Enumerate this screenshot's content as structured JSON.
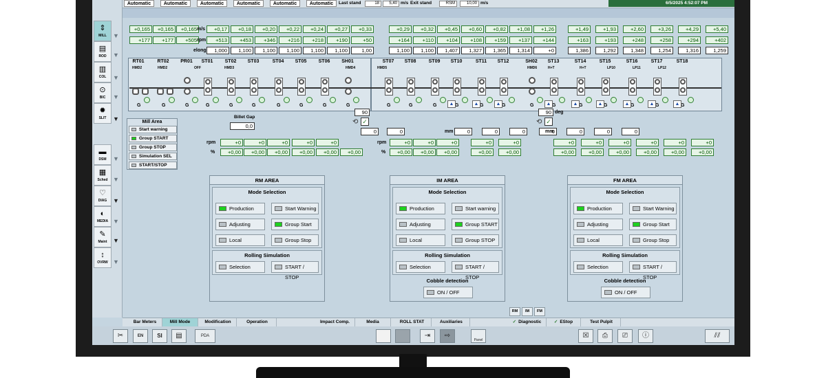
{
  "topbar": {
    "modes": [
      "Automatic",
      "Automatic",
      "Automatic",
      "Automatic",
      "Automatic",
      "Automatic"
    ],
    "last_stand_label": "Last stand",
    "last_stand_value": "18",
    "last_stand_speed": "5,40",
    "speed_unit": "m/s",
    "exit_stand_label": "Exit stand",
    "exit_stand_value": "RSM",
    "exit_stand_speed": "10,00",
    "exit_unit": "m/s",
    "datetime": "6/5/2025 4:52:07 PM"
  },
  "nav": [
    {
      "label": "MILL",
      "icon": "mill-icon",
      "glyph": "⇕"
    },
    {
      "label": "ROD",
      "icon": "rod-icon",
      "glyph": "▤"
    },
    {
      "label": "COL",
      "icon": "col-icon",
      "glyph": "▥"
    },
    {
      "label": "BIC",
      "icon": "bic-icon",
      "glyph": "⊙"
    },
    {
      "label": "SLIT",
      "icon": "slit-icon",
      "glyph": "✹"
    },
    {
      "label": "DSM",
      "icon": "dsm-icon",
      "glyph": "▬"
    },
    {
      "label": "Sched",
      "icon": "schedule-icon",
      "glyph": "▦"
    },
    {
      "label": "DIAG",
      "icon": "diag-icon",
      "glyph": "♡"
    },
    {
      "label": "MEDIA",
      "icon": "media-icon",
      "glyph": "◐"
    },
    {
      "label": "Maint",
      "icon": "maint-icon",
      "glyph": "✎"
    },
    {
      "label": "OVRW",
      "icon": "overview-icon",
      "glyph": "↕"
    }
  ],
  "units": {
    "ms": "m/s",
    "rpm": "rpm",
    "elong": "elong",
    "mm": "mm",
    "rpm2": "rpm",
    "pct": "%",
    "deg": "deg"
  },
  "speed_row": [
    "+0,165",
    "+0,165",
    "+0,165",
    "+0,17",
    "+0,18",
    "+0,20",
    "+0,22",
    "+0,24",
    "+0,27",
    "+0,33",
    "+0,29",
    "+0,32",
    "+0,45",
    "+0,60",
    "+0,82",
    "+1,08",
    "+1,26",
    "+1,49",
    "+1,93",
    "+2,60",
    "+3,26",
    "+4,29",
    "+5,40"
  ],
  "rpm_row": [
    "+177",
    "+177",
    "+505",
    "+513",
    "+453",
    "+346",
    "+216",
    "+218",
    "+190",
    "+50",
    "+164",
    "+110",
    "+104",
    "+108",
    "+159",
    "+137",
    "+144",
    "+163",
    "+193",
    "+248",
    "+258",
    "+294",
    "+402"
  ],
  "elong_row": [
    "1,000",
    "1,100",
    "1,100",
    "1,100",
    "1,100",
    "1,100",
    "1,00",
    "1,100",
    "1,100",
    "1,407",
    "1,327",
    "1,365",
    "1,314",
    "+0",
    "1,386",
    "1,292",
    "1,348",
    "1,254",
    "1,316",
    "1,259"
  ],
  "stands": [
    "RT01",
    "RT02",
    "PR01",
    "ST01",
    "ST02",
    "ST03",
    "ST04",
    "ST05",
    "ST06",
    "SH01",
    "ST07",
    "ST08",
    "ST09",
    "ST10",
    "ST11",
    "ST12",
    "SH02",
    "ST13",
    "ST14",
    "ST15",
    "ST16",
    "ST17",
    "ST18"
  ],
  "hmd": [
    "HMD2",
    "HMD2",
    "OFF",
    "HMD3",
    "HMD4",
    "HMD5",
    "HMD6",
    "H+T",
    "H+T",
    "LP10",
    "LP11",
    "LP12",
    "LP13",
    "LP14",
    "LP15",
    "LP16",
    "LP17"
  ],
  "g_label": "G",
  "sh01_value": "90",
  "sh02_value": "90",
  "billet_gap": {
    "label": "Billet Gap",
    "value": "0,0"
  },
  "mill_area": {
    "title": "Mill Area",
    "items": [
      {
        "label": "Start warning",
        "on": false
      },
      {
        "label": "Group START",
        "on": true
      },
      {
        "label": "Group STOP",
        "on": false
      },
      {
        "label": "Simulation SEL",
        "on": false
      },
      {
        "label": "START/STOP",
        "on": false
      }
    ]
  },
  "mm_row": [
    "0",
    "0",
    "0",
    "0",
    "0",
    "0",
    "0",
    "0",
    "0"
  ],
  "rpm_corr_a": [
    "+0",
    "+0",
    "+0",
    "+0",
    "+0"
  ],
  "pct_corr_a": [
    "+0,00",
    "+0,00",
    "+0,00",
    "+0,00",
    "+0,00",
    "+0,00"
  ],
  "rpm_corr_b": [
    "+0",
    "+0",
    "+0",
    "+0",
    "+0",
    "+0",
    "+0",
    "+0",
    "+0",
    "+0",
    "+0",
    "+0",
    "+0"
  ],
  "pct_corr_b": [
    "+0,00",
    "+0,00",
    "+0,00",
    "+0,00",
    "+0,00",
    "+0,00",
    "+0,00",
    "+0,00",
    "+0,00",
    "+0,00",
    "+0,00",
    "+0,00",
    "+0,00"
  ],
  "areas": [
    {
      "title": "RM AREA",
      "mode_title": "Mode Selection",
      "buttons": [
        {
          "label": "Production",
          "on": true
        },
        {
          "label": "Start Warning",
          "on": false
        },
        {
          "label": "Adjusting",
          "on": false
        },
        {
          "label": "Group Start",
          "on": true
        },
        {
          "label": "Local",
          "on": false
        },
        {
          "label": "Group Stop",
          "on": false
        }
      ],
      "sim_title": "Rolling Simulation",
      "sim_buttons": [
        {
          "label": "Selection"
        },
        {
          "label": "START / STOP"
        }
      ]
    },
    {
      "title": "IM AREA",
      "mode_title": "Mode Selection",
      "buttons": [
        {
          "label": "Production",
          "on": true
        },
        {
          "label": "Start warning",
          "on": false
        },
        {
          "label": "Adjusting",
          "on": false
        },
        {
          "label": "Group START",
          "on": true
        },
        {
          "label": "Local",
          "on": false
        },
        {
          "label": "Group STOP",
          "on": false
        }
      ],
      "sim_title": "Rolling Simulation",
      "sim_buttons": [
        {
          "label": "Selection"
        },
        {
          "label": "START / STOP"
        }
      ],
      "cobble_title": "Cobble detection",
      "cobble_button": "ON / OFF"
    },
    {
      "title": "FM AREA",
      "mode_title": "Mode Selection",
      "buttons": [
        {
          "label": "Production",
          "on": true
        },
        {
          "label": "Start Warning",
          "on": false
        },
        {
          "label": "Adjusting",
          "on": false
        },
        {
          "label": "Group Start",
          "on": true
        },
        {
          "label": "Local",
          "on": false
        },
        {
          "label": "Group Stop",
          "on": false
        }
      ],
      "sim_title": "Rolling Simulation",
      "sim_buttons": [
        {
          "label": "Selection"
        },
        {
          "label": "START / STOP"
        }
      ],
      "cobble_title": "Cobble detection",
      "cobble_button": "ON / OFF"
    }
  ],
  "tabs": [
    "Bar Meters",
    "Mill Mode",
    "Modification",
    "Operation",
    "Impact Comp.",
    "Media",
    "ROLL STAT",
    "Auxiliaries",
    "Diagnostic",
    "EStop",
    "Test Pulpit"
  ],
  "area_flags": [
    "RM",
    "IM",
    "FM"
  ],
  "toolbar": {
    "lang": "EN",
    "si": "SI",
    "panel": "Panel",
    "pda": "PDA"
  }
}
